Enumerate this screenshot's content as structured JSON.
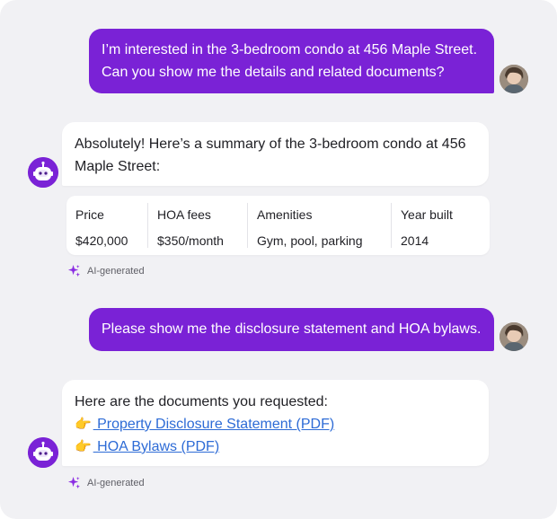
{
  "colors": {
    "background": "#f1f1f4",
    "user_bubble": "#7a22d6",
    "bot_bubble": "#ffffff",
    "link": "#2d6bd6",
    "ai_sparkle": "#8a2be2"
  },
  "messages": {
    "user_1": {
      "line1": "I’m interested in the 3-bedroom condo at 456 Maple Street.",
      "line2": "Can you show me the details and related documents?"
    },
    "bot_1": {
      "line1": "Absolutely! Here’s a summary of the 3-bedroom condo at 456",
      "line2": "Maple Street:"
    },
    "details_table": {
      "columns": [
        {
          "header": "Price",
          "value": "$420,000"
        },
        {
          "header": "HOA fees",
          "value": "$350/month"
        },
        {
          "header": "Amenities",
          "value": "Gym, pool, parking"
        },
        {
          "header": "Year built",
          "value": "2014"
        }
      ]
    },
    "ai_label_1": "AI-generated",
    "user_2": {
      "text": "Please show me the disclosure statement and HOA bylaws."
    },
    "bot_2": {
      "intro": "Here are the documents you requested:",
      "pointer_icon": "pointing-hand-icon",
      "links": [
        {
          "text": " Property Disclosure Statement (PDF)"
        },
        {
          "text": " HOA Bylaws (PDF)"
        }
      ]
    },
    "ai_label_2": "AI-generated"
  },
  "icons": {
    "ai_sparkle": "sparkle-icon",
    "bot_avatar": "robot-icon",
    "user_avatar": "user-photo"
  }
}
